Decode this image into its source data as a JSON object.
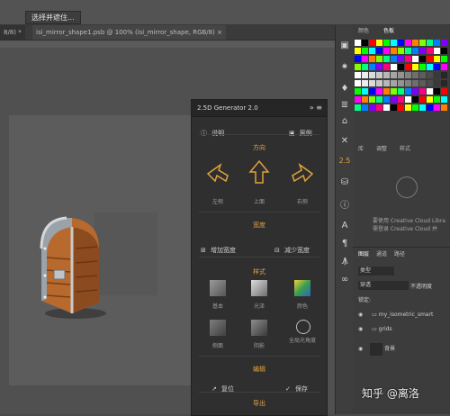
{
  "toolbar": {
    "select_label": "选择并遮住..."
  },
  "tabs": [
    {
      "label": "8/8) *"
    },
    {
      "label": "isi_mirror_shape1.psb @ 100% (isi_mirror_shape, RGB/8) ×"
    }
  ],
  "plugin": {
    "title": "2.5D Generator 2.0",
    "help_label": "说明",
    "example_label": "案例",
    "direction": {
      "title": "方向",
      "left": "左侧",
      "up": "上面",
      "right": "右侧"
    },
    "width": {
      "title": "宽度",
      "increase": "增加宽度",
      "decrease": "减少宽度"
    },
    "style": {
      "title": "样式",
      "basic": "基本",
      "gloss": "光泽",
      "color": "颜色",
      "side": "侧面",
      "shadow": "阴影",
      "angle": "全局光角度"
    },
    "edit": {
      "title": "编辑",
      "reset": "复位",
      "save": "保存"
    },
    "export": {
      "title": "导出"
    }
  },
  "right_panel": {
    "color_tabs": [
      "颜色",
      "色板"
    ],
    "lib_tabs": [
      "库",
      "调整",
      "样式"
    ],
    "cc_text_1": "要使用 Creative Cloud Libra",
    "cc_text_2": "需登录 Creative Cloud 并",
    "layer_tabs": [
      "图层",
      "通道",
      "路径"
    ],
    "filter_kind": "类型",
    "blend_mode": "穿透",
    "opacity_label": "不透明度",
    "lock_label": "锁定:",
    "layers": [
      {
        "name": "my_isometric_smart"
      },
      {
        "name": "grids"
      },
      {
        "name": "背景"
      }
    ]
  },
  "strip_badge": "2.5",
  "watermark": "知乎 @离洛"
}
